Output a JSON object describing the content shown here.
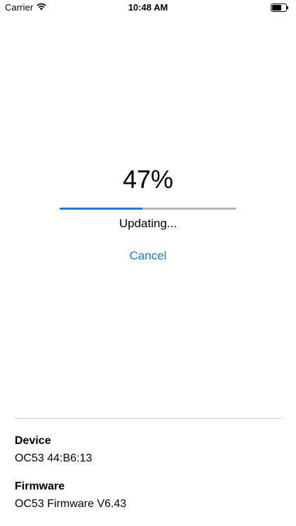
{
  "status_bar": {
    "carrier": "Carrier",
    "time": "10:48 AM",
    "battery_level": 0.7
  },
  "update": {
    "percent_text": "47%",
    "progress": 0.47,
    "status_text": "Updating...",
    "cancel_label": "Cancel",
    "accent_color": "#1a7bd4"
  },
  "info": {
    "device_label": "Device",
    "device_value": "OC53 44:B6:13",
    "firmware_label": "Firmware",
    "firmware_value": "OC53 Firmware V6.43"
  }
}
